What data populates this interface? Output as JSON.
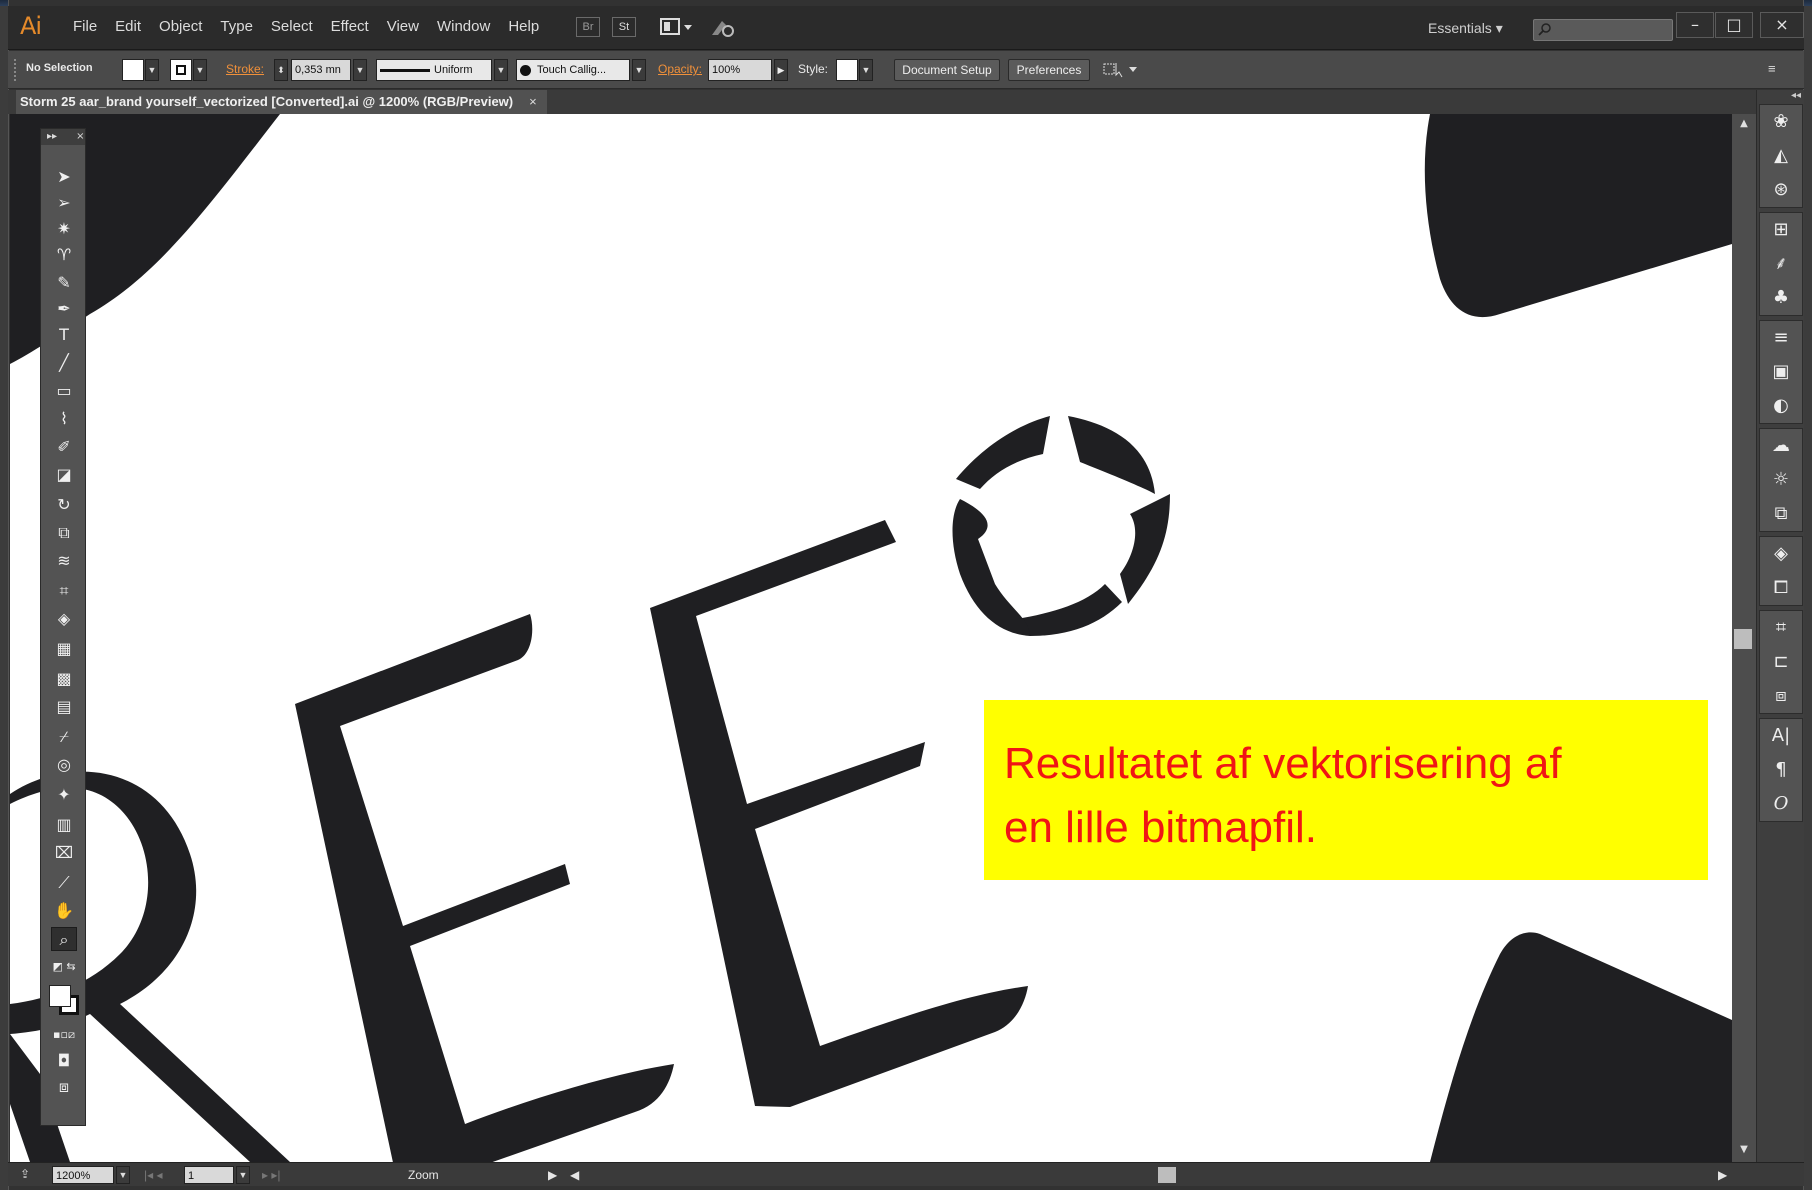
{
  "app": {
    "logo": "Ai",
    "menu": [
      "File",
      "Edit",
      "Object",
      "Type",
      "Select",
      "Effect",
      "View",
      "Window",
      "Help"
    ],
    "bridge_btns": [
      "Br",
      "St"
    ],
    "workspace": "Essentials",
    "window_controls": [
      "–",
      "□",
      "×"
    ]
  },
  "control_bar": {
    "selection": "No Selection",
    "stroke_label": "Stroke:",
    "stroke_value": "0,353 mn",
    "profile": "Uniform",
    "brush": "Touch Callig...",
    "opacity_label": "Opacity:",
    "opacity_value": "100%",
    "style_label": "Style:",
    "doc_setup": "Document Setup",
    "preferences": "Preferences"
  },
  "document": {
    "tab_title": "Storm 25 aar_brand yourself_vectorized [Converted].ai @ 1200% (RGB/Preview)",
    "close": "×"
  },
  "status_bar": {
    "zoom": "1200%",
    "artboard": "1",
    "status": "Zoom"
  },
  "annotation": {
    "line1": "Resultatet af vektorisering af",
    "line2": "en lille bitmapfil."
  },
  "colors": {
    "annotation_bg": "#ffff00",
    "annotation_text": "#f01515",
    "artwork": "#1f1f22",
    "accent": "#f0903a"
  },
  "tools": [
    "selection-icon",
    "direct-selection-icon",
    "magic-wand-icon",
    "lasso-icon",
    "pen-icon",
    "type-icon",
    "line-icon",
    "rectangle-icon",
    "paintbrush-icon",
    "blob-brush-icon",
    "eraser-icon",
    "rotate-icon",
    "scale-icon",
    "width-icon",
    "free-transform-icon",
    "shape-builder-icon",
    "perspective-grid-icon",
    "mesh-icon",
    "gradient-icon",
    "eyedropper-icon",
    "blend-icon",
    "symbol-sprayer-icon",
    "column-graph-icon",
    "artboard-icon",
    "slice-icon",
    "hand-icon",
    "zoom-icon"
  ],
  "dock_icons": [
    "color-icon",
    "color-guide-icon",
    "brushes-icon",
    "swatches-icon",
    "symbols-icon",
    "graphic-styles-icon",
    "stroke-icon",
    "gradient-panel-icon",
    "transparency-icon",
    "appearance-icon",
    "libraries-icon",
    "image-trace-icon",
    "layers-icon",
    "artboards-icon",
    "transform-icon",
    "align-icon",
    "pathfinder-icon",
    "character-icon",
    "paragraph-icon",
    "opentype-icon"
  ]
}
